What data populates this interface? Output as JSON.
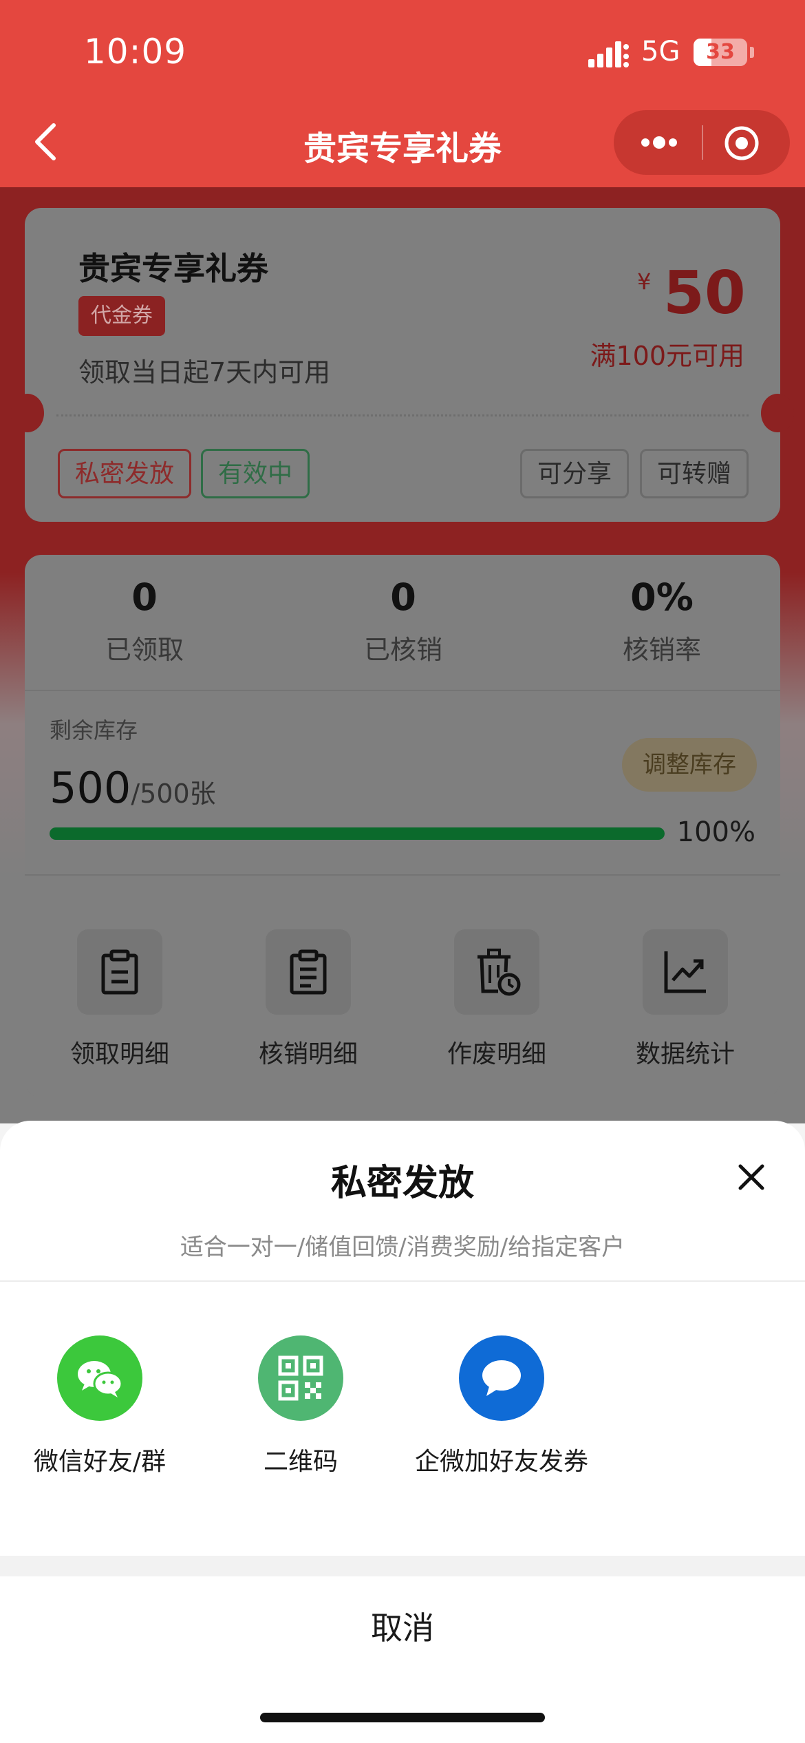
{
  "status_bar": {
    "time": "10:09",
    "network": "5G",
    "battery": "33",
    "battery_level": 0.33
  },
  "nav": {
    "title": "贵宾专享礼券",
    "back_icon": "chevron-left-icon",
    "more_icon": "more-dots-icon",
    "record_icon": "target-icon"
  },
  "coupon": {
    "title": "贵宾专享礼券",
    "type_tag": "代金券",
    "validity": "领取当日起7天内可用",
    "currency": "¥",
    "amount": "50",
    "threshold": "满100元可用",
    "tags": {
      "private": "私密发放",
      "active": "有效中",
      "share": "可分享",
      "transfer": "可转赠"
    }
  },
  "stats": {
    "items": [
      {
        "value": "0",
        "label": "已领取"
      },
      {
        "value": "0",
        "label": "已核销"
      },
      {
        "value": "0%",
        "label": "核销率"
      }
    ],
    "stock_label": "剩余库存",
    "stock_remaining": "500",
    "stock_total": "/500张",
    "stock_fraction": 1.0,
    "stock_percent": "100%",
    "adjust_button": "调整库存"
  },
  "actions": [
    {
      "label": "领取明细",
      "icon": "clipboard-icon"
    },
    {
      "label": "核销明细",
      "icon": "clipboard-list-icon"
    },
    {
      "label": "作废明细",
      "icon": "trash-clock-icon"
    },
    {
      "label": "数据统计",
      "icon": "chart-trend-icon"
    }
  ],
  "sheet": {
    "title": "私密发放",
    "subtitle": "适合一对一/储值回馈/消费奖励/给指定客户",
    "options": [
      {
        "label": "微信好友/群",
        "icon": "wechat-icon",
        "color": "#3cc83c"
      },
      {
        "label": "二维码",
        "icon": "qrcode-icon",
        "color": "#4fb672"
      },
      {
        "label": "企微加好友发券",
        "icon": "chat-bubble-icon",
        "color": "#0f6bd6"
      }
    ],
    "cancel": "取消"
  },
  "colors": {
    "brand_red": "#e4473f",
    "coupon_red": "#c7302c",
    "success_green": "#0b6a2c"
  }
}
